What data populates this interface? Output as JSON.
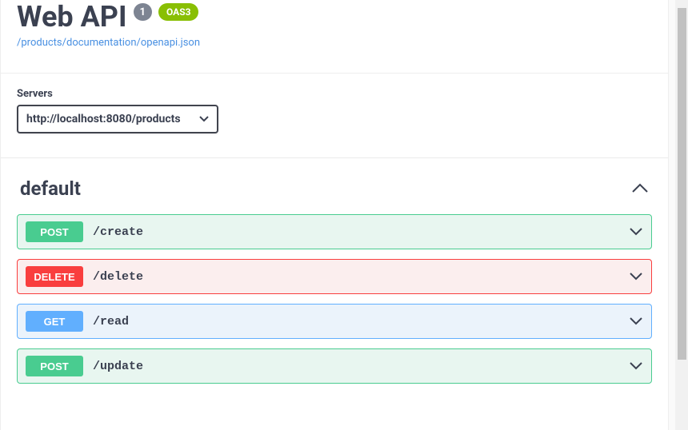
{
  "header": {
    "title": "Web API",
    "version": "1",
    "oas": "OAS3",
    "doc_link": "/products/documentation/openapi.json"
  },
  "servers": {
    "label": "Servers",
    "selected": "http://localhost:8080/products"
  },
  "tag": {
    "name": "default"
  },
  "ops": [
    {
      "method": "POST",
      "path": "/create",
      "css": "op-post",
      "mcss": "method-post"
    },
    {
      "method": "DELETE",
      "path": "/delete",
      "css": "op-delete",
      "mcss": "method-delete"
    },
    {
      "method": "GET",
      "path": "/read",
      "css": "op-get",
      "mcss": "method-get"
    },
    {
      "method": "POST",
      "path": "/update",
      "css": "op-post",
      "mcss": "method-post"
    }
  ]
}
